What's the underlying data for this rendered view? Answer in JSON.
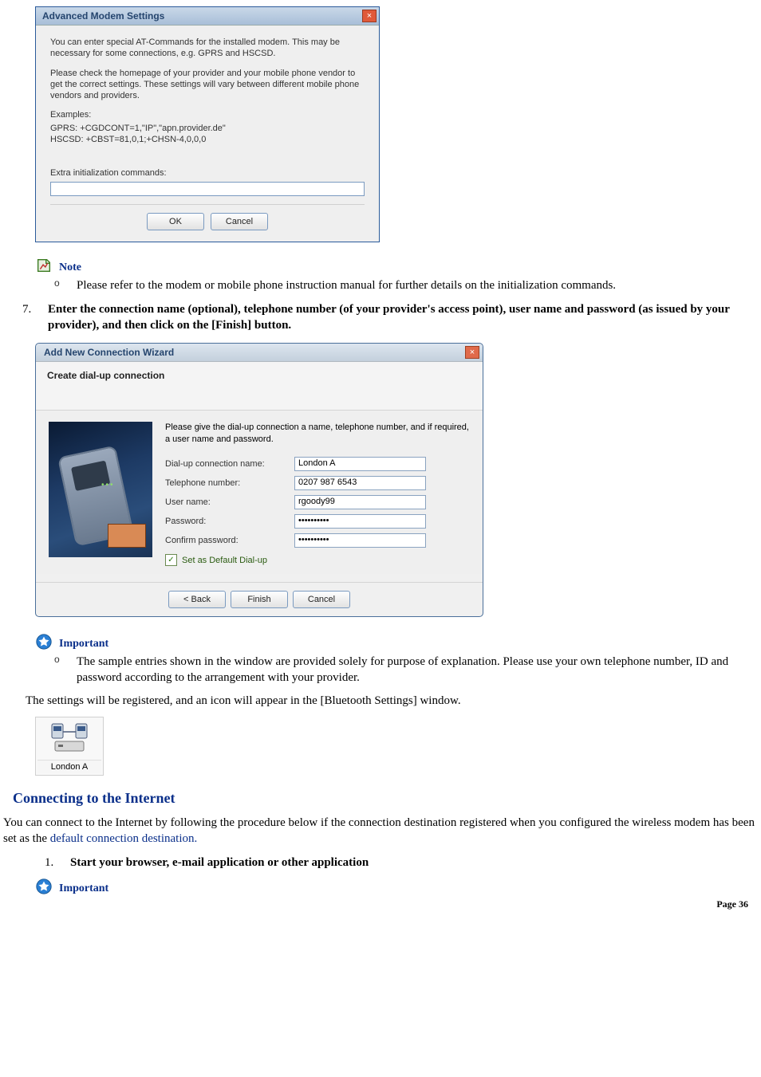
{
  "dialog1": {
    "title": "Advanced Modem Settings",
    "close": "×",
    "p1": "You can enter special AT-Commands for the installed modem. This may be necessary for some connections, e.g. GPRS and HSCSD.",
    "p2": "Please check the homepage of your provider and your mobile phone vendor to get the correct settings. These settings will vary between different mobile phone vendors and providers.",
    "ex_h": "Examples:",
    "ex1": "GPRS: +CGDCONT=1,\"IP\",\"apn.provider.de\"",
    "ex2": "HSCSD: +CBST=81,0,1;+CHSN-4,0,0,0",
    "extra_label": "Extra initialization commands:",
    "extra_value": "",
    "ok": "OK",
    "cancel": "Cancel"
  },
  "note1": {
    "label": "Note",
    "bullet": "Please refer to the modem or mobile phone instruction manual for further details on the initialization commands."
  },
  "step7": {
    "num": "7.",
    "text": "Enter the connection name (optional), telephone number (of your provider's access point), user name and password (as issued by your provider), and then click on the [Finish] button."
  },
  "wizard": {
    "title": "Add New Connection Wizard",
    "close": "×",
    "subhead": "Create dial-up connection",
    "intro": "Please give the dial-up connection a name, telephone number, and if required, a user name and password.",
    "labels": {
      "conn": "Dial-up connection name:",
      "tel": "Telephone number:",
      "user": "User name:",
      "pass": "Password:",
      "confirm": "Confirm password:"
    },
    "values": {
      "conn": "London A",
      "tel": "0207 987 6543",
      "user": "rgoody99",
      "pass": "••••••••••",
      "confirm": "••••••••••"
    },
    "checkbox": "Set as Default Dial-up",
    "back": "< Back",
    "finish": "Finish",
    "cancel": "Cancel"
  },
  "important1": {
    "label": "Important",
    "bullet": "The sample entries shown in the window are provided solely for purpose of explanation. Please use your own telephone number, ID and password according to the arrangement with your provider."
  },
  "registered_para": "The settings will be registered, and an icon will appear in the [Bluetooth Settings] window.",
  "icon_tile_label": "London A",
  "section_heading": "Connecting to the Internet",
  "connect_para_a": "You can connect to the Internet by following the procedure below if the connection destination registered when you configured the wireless modem has been set as the ",
  "connect_para_link": "default connection destination.",
  "step1": {
    "num": "1.",
    "text": "Start your browser, e-mail application or other application"
  },
  "important2": {
    "label": "Important"
  },
  "page_num": "Page 36"
}
